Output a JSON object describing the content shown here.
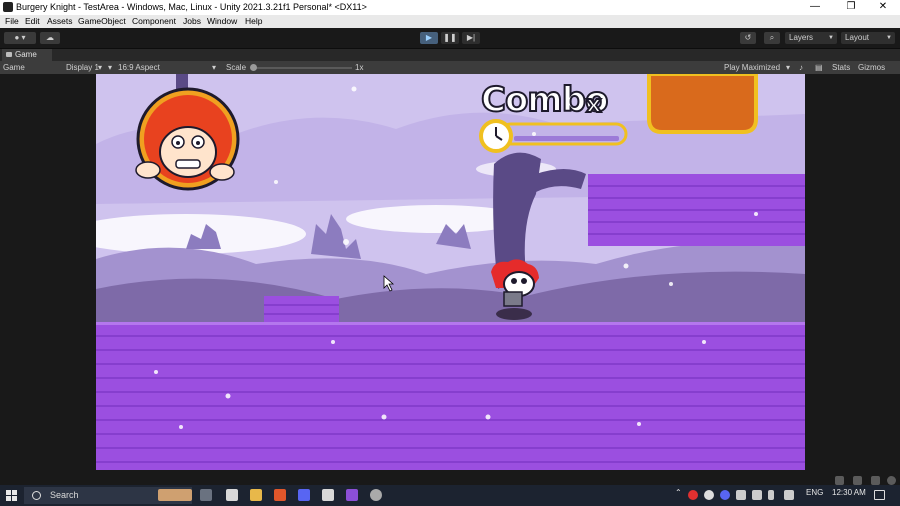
{
  "window": {
    "title": "Burgery Knight - TestArea - Windows, Mac, Linux - Unity 2021.3.21f1 Personal* <DX11>",
    "minimize": "—",
    "maximize": "❐",
    "close": "✕"
  },
  "menu": [
    "File",
    "Edit",
    "Assets",
    "GameObject",
    "Component",
    "Jobs",
    "Window",
    "Help"
  ],
  "toolbar": {
    "layers_label": "Layers",
    "layout_label": "Layout"
  },
  "game_tab": {
    "label": "Game"
  },
  "game_bar": {
    "mode": "Game",
    "display": "Display 1",
    "aspect": "16:9 Aspect",
    "scale_label": "Scale",
    "scale_value": "1x",
    "play_maximized": "Play Maximized",
    "stats": "Stats",
    "gizmos": "Gizmos"
  },
  "game_hud": {
    "combo_text": "Combo",
    "combo_x": "x"
  },
  "taskbar": {
    "search_placeholder": "Search",
    "language": "ENG",
    "time": "12:30 AM"
  },
  "colors": {
    "brick_purple": "#9b4fe0",
    "sky_lavender": "#cfc3ee",
    "hud_gold": "#f0c020",
    "accent_play": "#9cd1ff"
  }
}
